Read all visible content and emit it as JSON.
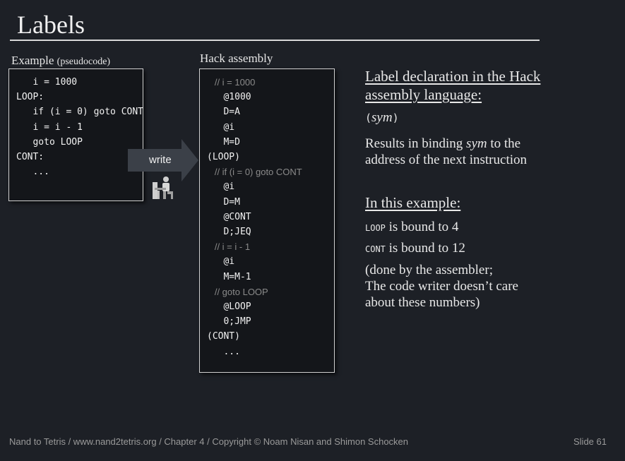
{
  "slide": {
    "title": "Labels",
    "footer_left": "Nand to Tetris / www.nand2tetris.org / Chapter 4 / Copyright © Noam Nisan and Shimon Schocken",
    "footer_right": "Slide 61"
  },
  "example": {
    "caption_main": "Example",
    "caption_small": "(pseudocode)",
    "lines": [
      "   i = 1000",
      "LOOP:",
      "   if (i = 0) goto CONT",
      "   i = i - 1",
      "   goto LOOP",
      "CONT:",
      "   ..."
    ]
  },
  "arrow": {
    "label": "write",
    "icon": "person-at-desk-icon"
  },
  "hack": {
    "caption": "Hack assembly",
    "lines": [
      {
        "t": "   // i = 1000",
        "k": "c"
      },
      {
        "t": "   @1000",
        "k": "code"
      },
      {
        "t": "   D=A",
        "k": "code"
      },
      {
        "t": "   @i",
        "k": "code"
      },
      {
        "t": "   M=D",
        "k": "code"
      },
      {
        "t": "(LOOP)",
        "k": "code"
      },
      {
        "t": "   // if (i = 0) goto CONT",
        "k": "c"
      },
      {
        "t": "   @i",
        "k": "code"
      },
      {
        "t": "   D=M",
        "k": "code"
      },
      {
        "t": "   @CONT",
        "k": "code"
      },
      {
        "t": "   D;JEQ",
        "k": "code"
      },
      {
        "t": "   // i = i - 1",
        "k": "c"
      },
      {
        "t": "   @i",
        "k": "code"
      },
      {
        "t": "   M=M-1",
        "k": "code"
      },
      {
        "t": "   // goto LOOP",
        "k": "c"
      },
      {
        "t": "   @LOOP",
        "k": "code"
      },
      {
        "t": "   0;JMP",
        "k": "code"
      },
      {
        "t": "(CONT)",
        "k": "code"
      },
      {
        "t": "   ...",
        "k": "code"
      }
    ]
  },
  "right": {
    "heading1_line1": "Label declaration in the Hack",
    "heading1_line2": "assembly language:",
    "sym_open": "(",
    "sym": "sym",
    "sym_close": ")",
    "binding_pre": "Results in binding ",
    "binding_sym": "sym",
    "binding_post": " to the",
    "binding_line2": "address of the next instruction",
    "heading2": "In this example:",
    "loop_label": "LOOP",
    "loop_text": " is bound to 4",
    "cont_label": "CONT",
    "cont_text": " is bound to 12",
    "note_line1": "(done by the assembler;",
    "note_line2": "The code writer doesn’t care",
    "note_line3": "about these numbers)"
  },
  "colors": {
    "background": "#1d2026",
    "comment": "#8a8a8a",
    "text": "#e8e8e8"
  }
}
